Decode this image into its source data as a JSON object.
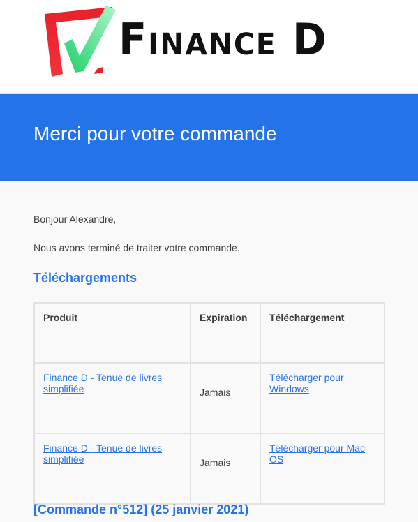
{
  "logo": {
    "text": "Finance D",
    "icon": "checkmark-in-box-icon"
  },
  "header": {
    "title": "Merci pour votre commande",
    "color": "#2573e8"
  },
  "body": {
    "greeting": "Bonjour Alexandre,",
    "intro": "Nous avons terminé de traiter votre commande."
  },
  "downloads": {
    "title": "Téléchargements",
    "columns": [
      "Produit",
      "Expiration",
      "Téléchargement"
    ],
    "rows": [
      {
        "product": "Finance D - Tenue de livres simplifiée",
        "expiration": "Jamais",
        "download": "Télécharger pour Windows"
      },
      {
        "product": "Finance D - Tenue de livres simplifiée",
        "expiration": "Jamais",
        "download": "Télécharger pour Mac OS"
      }
    ]
  },
  "order": {
    "title": "[Commande n°512] (25 janvier 2021)"
  },
  "colors": {
    "accent": "#2573e8",
    "logo_red": "#e8202a",
    "logo_green": "#2ee27a"
  }
}
